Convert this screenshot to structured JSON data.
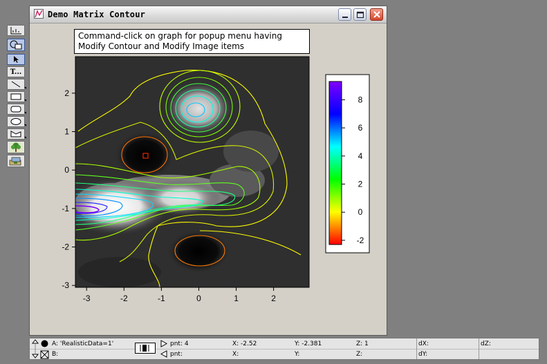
{
  "window": {
    "title": "Demo Matrix Contour",
    "buttons": [
      "minimize",
      "maximize",
      "close"
    ]
  },
  "annotation": {
    "line1": "Command-click on graph for popup menu having",
    "line2": "Modify Contour and Modify Image items"
  },
  "toolbar": {
    "tools": [
      "graph-tool-icon",
      "shapes-mode-icon",
      "arrow-pointer-icon",
      "text-tool-icon",
      "line-tool-icon",
      "rectangle-tool-icon",
      "rounded-rect-tool-icon",
      "oval-tool-icon",
      "polygon-tool-icon",
      "tree-picture-icon",
      "image-layer-icon"
    ],
    "text_tool_label": "T..."
  },
  "chart_data": {
    "type": "heatmap",
    "title": "",
    "xlabel": "",
    "ylabel": "",
    "xlim": [
      -3.3,
      2.95
    ],
    "ylim": [
      -3.05,
      2.95
    ],
    "x_ticks": [
      -3,
      -2,
      -1,
      0,
      1,
      2
    ],
    "y_ticks": [
      -3,
      -2,
      -1,
      0,
      1,
      2
    ],
    "image": "grayscale",
    "contour_levels": [
      -2,
      -1,
      0,
      1,
      2,
      3,
      4,
      5,
      6,
      7,
      8,
      9
    ],
    "features": [
      {
        "kind": "peak",
        "x": -2.6,
        "y": -0.9,
        "value": 9.3
      },
      {
        "kind": "peak",
        "x": 0.0,
        "y": 1.6,
        "value": 6.0
      },
      {
        "kind": "trough",
        "x": -1.3,
        "y": 0.45,
        "value": -2.2
      },
      {
        "kind": "trough",
        "x": 0.1,
        "y": -2.05,
        "value": -1.8
      }
    ],
    "colorbar": {
      "range": [
        -2.3,
        9.3
      ],
      "ticks": [
        -2,
        0,
        2,
        4,
        6,
        8
      ],
      "colormap": [
        "#ff0000",
        "#ffff00",
        "#00ff00",
        "#00ffff",
        "#0000ff",
        "#8000ff"
      ]
    }
  },
  "infobar": {
    "traceA": "A: 'RealisticData=1'",
    "traceB": "B:",
    "pnt_label": "pnt: 4",
    "pnt2_label": "pnt:",
    "x_label": "X: -2.52",
    "x2_label": "X:",
    "y_label": "Y: -2.381",
    "y2_label": "Y:",
    "z_label": "Z: 1",
    "z2_label": "Z:",
    "dx_label": "dX:",
    "dy_label": "dY:",
    "dz_label": "dZ:"
  }
}
